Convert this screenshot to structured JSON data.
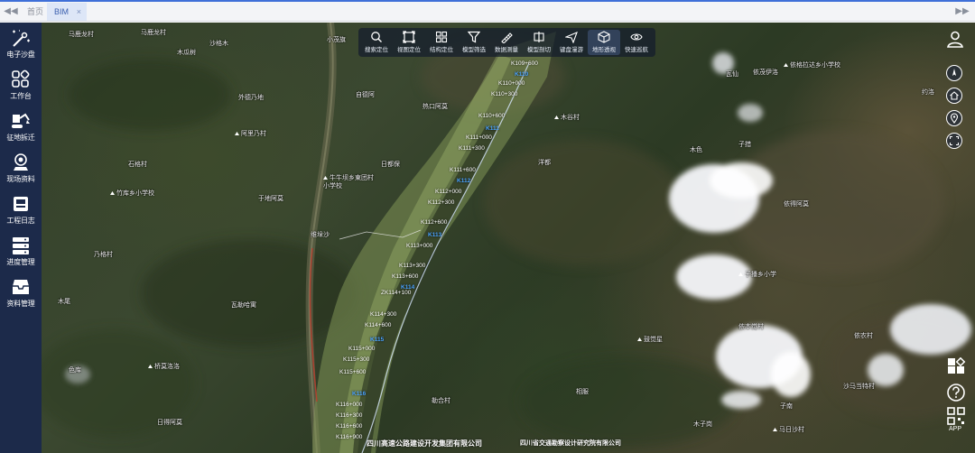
{
  "tabs": {
    "home": "首页",
    "bim": "BIM",
    "close": "×",
    "prev": "◀◀",
    "next": "▶▶"
  },
  "sidebar": {
    "items": [
      {
        "label": "电子沙盘",
        "icon": "sandbox-icon"
      },
      {
        "label": "工作台",
        "icon": "workbench-icon"
      },
      {
        "label": "征地拆迁",
        "icon": "excavator-icon"
      },
      {
        "label": "现场资料",
        "icon": "site-data-icon"
      },
      {
        "label": "工程日志",
        "icon": "log-icon"
      },
      {
        "label": "进度管理",
        "icon": "progress-icon"
      },
      {
        "label": "资料管理",
        "icon": "archive-icon"
      }
    ]
  },
  "toolbar": {
    "items": [
      {
        "label": "搜索定位",
        "icon": "search-icon"
      },
      {
        "label": "视图定位",
        "icon": "view-frame-icon"
      },
      {
        "label": "结构定位",
        "icon": "structure-grid-icon"
      },
      {
        "label": "模型筛选",
        "icon": "filter-icon"
      },
      {
        "label": "数据测量",
        "icon": "measure-icon"
      },
      {
        "label": "模型剖切",
        "icon": "section-icon"
      },
      {
        "label": "键盘漫游",
        "icon": "plane-icon"
      },
      {
        "label": "地形透视",
        "icon": "cube-icon"
      },
      {
        "label": "快速巡航",
        "icon": "eye-icon"
      }
    ],
    "active_index": 7
  },
  "right_controls": {
    "app_label": "APP"
  },
  "map": {
    "places": [
      {
        "text": "马鹿龙村"
      },
      {
        "text": "马鹿龙村"
      },
      {
        "text": "小茂旗"
      },
      {
        "text": "木瓜树"
      },
      {
        "text": "沙格木"
      },
      {
        "text": "外德乃地"
      },
      {
        "text": "阿里乃村"
      },
      {
        "text": "石格村"
      },
      {
        "text": "竹库乡小学校"
      },
      {
        "text": "乃格村"
      },
      {
        "text": "木尾"
      },
      {
        "text": "瓦勒哈寓"
      },
      {
        "text": "桥莫洛洛"
      },
      {
        "text": "日得阿莫"
      },
      {
        "text": "色库"
      },
      {
        "text": "牛牛坝乡東团村小学校"
      },
      {
        "text": "于地阿莫"
      },
      {
        "text": "维垛沙"
      },
      {
        "text": "自德阿"
      },
      {
        "text": "日都保"
      },
      {
        "text": "热口阿莫"
      },
      {
        "text": "木谷村"
      },
      {
        "text": "洋都"
      },
      {
        "text": "木色"
      },
      {
        "text": "子措"
      },
      {
        "text": "依得阿莫"
      },
      {
        "text": "子播乡小学"
      },
      {
        "text": "依本觉村"
      },
      {
        "text": "依格拉达乡小学校"
      },
      {
        "text": "约洛"
      },
      {
        "text": "瓦仙"
      },
      {
        "text": "依茂伊洛"
      },
      {
        "text": "鼓觉星"
      },
      {
        "text": "依农村"
      },
      {
        "text": "沙马当特村"
      },
      {
        "text": "勒合村"
      },
      {
        "text": "子南"
      },
      {
        "text": "相服"
      },
      {
        "text": "木子岗"
      },
      {
        "text": "马日沙村"
      }
    ],
    "chainages": [
      {
        "text": "K109+600"
      },
      {
        "text": "K110+000"
      },
      {
        "text": "K110+300"
      },
      {
        "text": "K110+600"
      },
      {
        "text": "K111+000"
      },
      {
        "text": "K111+300"
      },
      {
        "text": "K111+600"
      },
      {
        "text": "K112+000"
      },
      {
        "text": "K112+300"
      },
      {
        "text": "K112+600"
      },
      {
        "text": "K113+000"
      },
      {
        "text": "K113+300"
      },
      {
        "text": "K113+600"
      },
      {
        "text": "ZK114+100"
      },
      {
        "text": "K114+300"
      },
      {
        "text": "K114+600"
      },
      {
        "text": "K115+000"
      },
      {
        "text": "K115+300"
      },
      {
        "text": "K115+600"
      },
      {
        "text": "K116+000"
      },
      {
        "text": "K116+300"
      },
      {
        "text": "K116+600"
      },
      {
        "text": "K116+900"
      }
    ],
    "blue_markers": [
      {
        "text": "K110"
      },
      {
        "text": "K111"
      },
      {
        "text": "K112"
      },
      {
        "text": "K113"
      },
      {
        "text": "K114"
      },
      {
        "text": "K115"
      },
      {
        "text": "K116"
      }
    ]
  },
  "footer": {
    "company1": "四川高速公路建设开发集团有限公司",
    "company2": "四川省交通勘察设计研究院有限公司"
  },
  "colors": {
    "sidebar": "#1c2a4a",
    "accent": "#3f6fd8",
    "chain_blue": "#4aa3ff"
  }
}
